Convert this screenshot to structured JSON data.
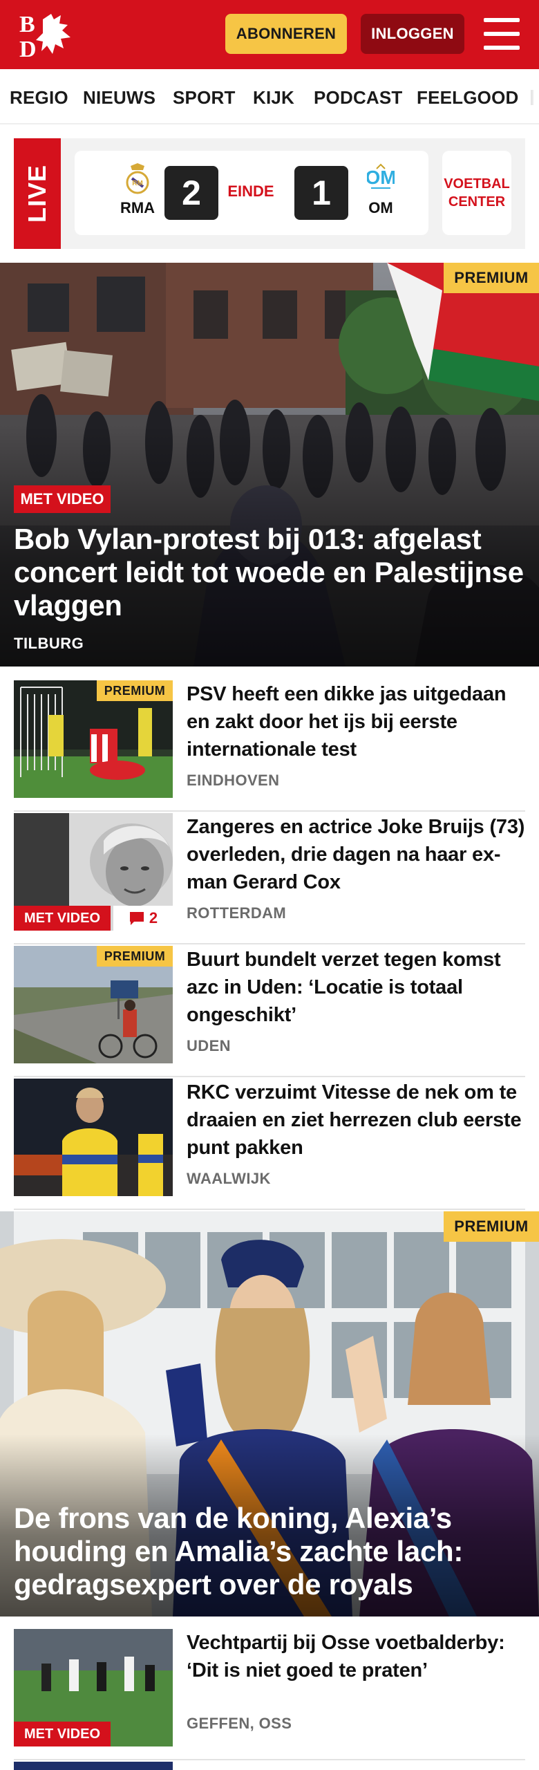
{
  "header": {
    "logo_text": "BD",
    "subscribe_label": "ABONNEREN",
    "login_label": "INLOGGEN"
  },
  "nav": {
    "items": [
      "REGIO",
      "NIEUWS",
      "SPORT",
      "KIJK",
      "PODCAST",
      "FEELGOOD"
    ]
  },
  "live": {
    "tag": "LIVE",
    "home_team": "RMA",
    "away_team": "OM",
    "home_score": "2",
    "away_score": "1",
    "status": "EINDE",
    "center_label_1": "VOETBAL",
    "center_label_2": "CENTER"
  },
  "hero": {
    "premium": "PREMIUM",
    "video": "MET VIDEO",
    "title": "Bob Vylan-protest bij 013: afgelast concert leidt tot woede en Palestijnse vlaggen",
    "location": "TILBURG"
  },
  "articles": [
    {
      "title": "PSV heeft een dikke jas uitgedaan en zakt door het ijs bij eerste internationale test",
      "location": "EINDHOVEN",
      "premium": "PREMIUM"
    },
    {
      "title": "Zangeres en actrice Joke Bruijs (73) overleden, drie dagen na haar ex-man Gerard Cox",
      "location": "ROTTERDAM",
      "video": "MET VIDEO",
      "comments": "2"
    },
    {
      "title": "Buurt bundelt verzet tegen komst azc in Uden: ‘Locatie is totaal ongeschikt’",
      "location": "UDEN",
      "premium": "PREMIUM"
    },
    {
      "title": "RKC verzuimt Vitesse de nek om te draaien en ziet herrezen club eerste punt pakken",
      "location": "WAALWIJK"
    }
  ],
  "hero2": {
    "premium": "PREMIUM",
    "title": "De frons van de koning, Alexia’s houding en Amalia’s zachte lach: gedragsexpert over de royals"
  },
  "article_bottom": {
    "title": "Vechtpartij bij Osse voetbalder­by: ‘Dit is niet goed te praten’",
    "location": "GEFFEN, OSS",
    "video": "MET VIDEO"
  },
  "colors": {
    "brand_red": "#d4111c",
    "premium_yellow": "#f6c545",
    "login_dark_red": "#8f0a12"
  }
}
